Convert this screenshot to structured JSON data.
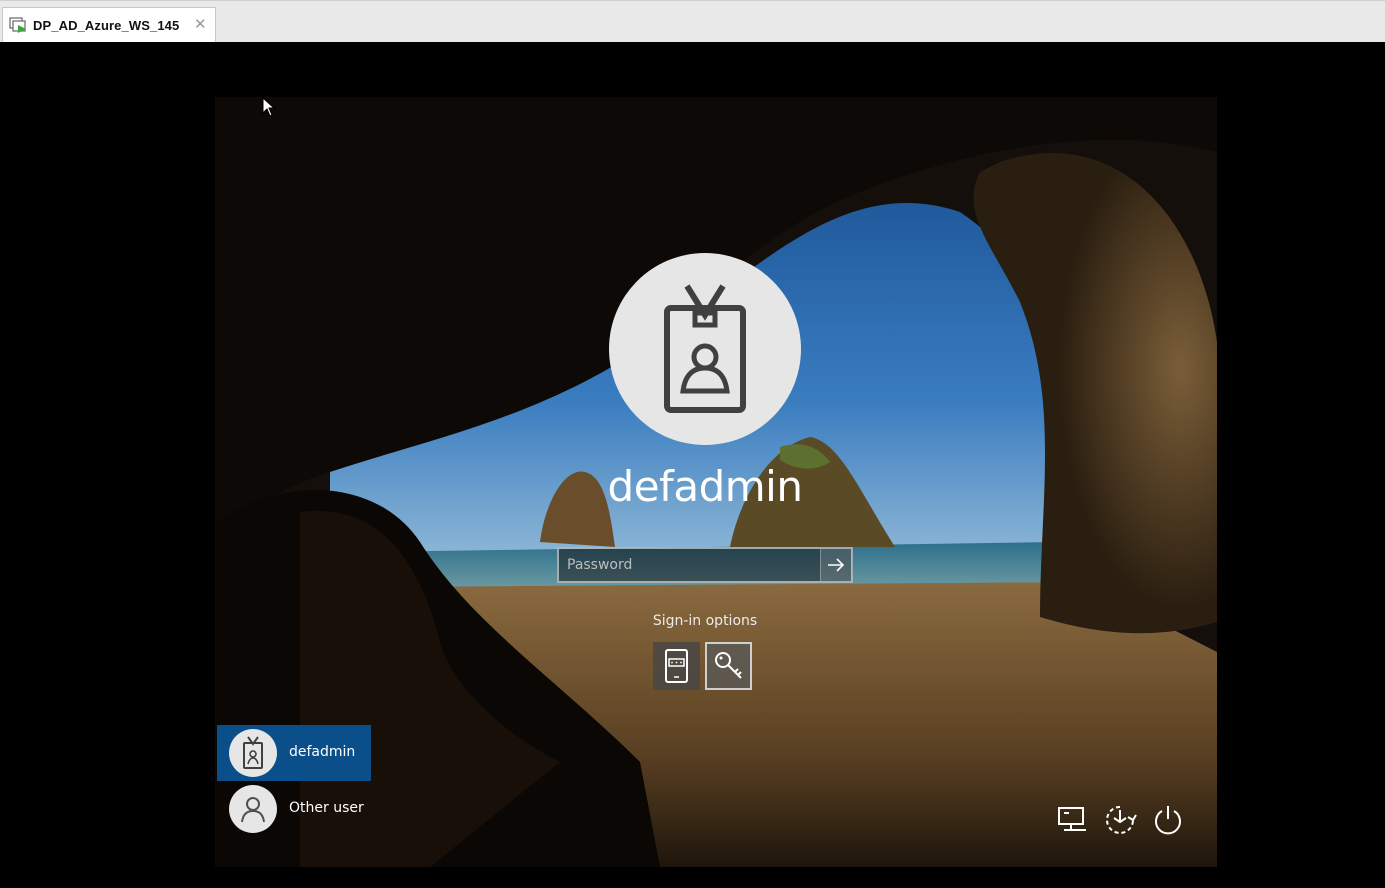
{
  "window": {
    "tab_title": "DP_AD_Azure_WS_145",
    "tab_icon": "vm-console-icon",
    "tab_close": "✕"
  },
  "login": {
    "username": "defadmin",
    "avatar_icon": "id-badge-icon",
    "password": {
      "value": "",
      "placeholder": "Password"
    },
    "submit_icon": "arrow-right-icon",
    "signin_options_label": "Sign-in options",
    "signin_options": [
      {
        "icon": "phone-pin-icon",
        "selected": false
      },
      {
        "icon": "key-icon",
        "selected": true
      }
    ]
  },
  "users": [
    {
      "label": "defadmin",
      "icon": "id-badge-icon",
      "selected": true
    },
    {
      "label": "Other user",
      "icon": "person-icon",
      "selected": false
    }
  ],
  "corner_buttons": [
    {
      "icon": "network-icon"
    },
    {
      "icon": "ease-of-access-icon"
    },
    {
      "icon": "power-icon"
    }
  ],
  "colors": {
    "selected_user_bg": "#0a4f8a",
    "avatar_bg": "#e6e6e6",
    "avatar_glyph": "#404040"
  }
}
